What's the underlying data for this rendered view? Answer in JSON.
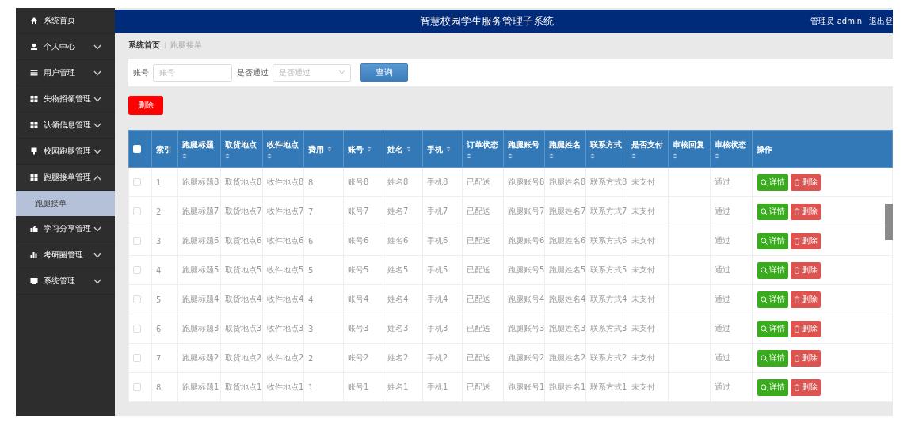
{
  "header": {
    "title": "智慧校园学生服务管理子系统",
    "user": "管理员 admin",
    "logout": "退出登"
  },
  "sidebar": {
    "items": [
      {
        "label": "系统首页",
        "kind": "link"
      },
      {
        "label": "个人中心",
        "kind": "menu",
        "expanded": false
      },
      {
        "label": "用户管理",
        "kind": "menu",
        "expanded": false
      },
      {
        "label": "失物招领管理",
        "kind": "menu",
        "expanded": false
      },
      {
        "label": "认领信息管理",
        "kind": "menu",
        "expanded": false
      },
      {
        "label": "校园跑腿管理",
        "kind": "menu",
        "expanded": false
      },
      {
        "label": "跑腿接单管理",
        "kind": "menu",
        "expanded": true,
        "children": [
          {
            "label": "跑腿接单",
            "selected": true
          }
        ]
      },
      {
        "label": "学习分享管理",
        "kind": "menu",
        "expanded": false
      },
      {
        "label": "考研圈管理",
        "kind": "menu",
        "expanded": false
      },
      {
        "label": "系统管理",
        "kind": "menu",
        "expanded": false
      }
    ]
  },
  "breadcrumb": [
    "系统首页",
    "跑腿接单"
  ],
  "search": {
    "fields": [
      {
        "label": "账号",
        "kind": "input",
        "placeholder": "账号"
      },
      {
        "label": "是否通过",
        "kind": "select",
        "placeholder": "是否通过"
      }
    ],
    "button": "查询"
  },
  "delete_button": "删除",
  "table": {
    "select_all_checked": false,
    "columns": [
      {
        "label": "索引",
        "sortable": false
      },
      {
        "label": "跑腿标题",
        "sortable": true
      },
      {
        "label": "取货地点",
        "sortable": true
      },
      {
        "label": "收件地点",
        "sortable": true
      },
      {
        "label": "费用",
        "sortable": true
      },
      {
        "label": "账号",
        "sortable": true
      },
      {
        "label": "姓名",
        "sortable": true
      },
      {
        "label": "手机",
        "sortable": true
      },
      {
        "label": "订单状态",
        "sortable": true
      },
      {
        "label": "跑腿账号",
        "sortable": true
      },
      {
        "label": "跑腿姓名",
        "sortable": true
      },
      {
        "label": "联系方式",
        "sortable": true
      },
      {
        "label": "是否支付",
        "sortable": true
      },
      {
        "label": "审核回复",
        "sortable": true
      },
      {
        "label": "审核状态",
        "sortable": true
      },
      {
        "label": "操作",
        "sortable": false
      }
    ],
    "rows": [
      {
        "checked": false,
        "cells": [
          "1",
          "跑腿标题8",
          "取货地点8",
          "收件地点8",
          "8",
          "账号8",
          "姓名8",
          "手机8",
          "已配送",
          "跑腿账号8",
          "跑腿姓名8",
          "联系方式8",
          "未支付",
          null,
          "通过"
        ],
        "actions": [
          "详情",
          "删除"
        ]
      },
      {
        "checked": false,
        "cells": [
          "2",
          "跑腿标题7",
          "取货地点7",
          "收件地点7",
          "7",
          "账号7",
          "姓名7",
          "手机7",
          "已配送",
          "跑腿账号7",
          "跑腿姓名7",
          "联系方式7",
          "未支付",
          null,
          "通过"
        ],
        "actions": [
          "详情",
          "删除"
        ]
      },
      {
        "checked": false,
        "cells": [
          "3",
          "跑腿标题6",
          "取货地点6",
          "收件地点6",
          "6",
          "账号6",
          "姓名6",
          "手机6",
          "已配送",
          "跑腿账号6",
          "跑腿姓名6",
          "联系方式6",
          "未支付",
          null,
          "通过"
        ],
        "actions": [
          "详情",
          "删除"
        ]
      },
      {
        "checked": false,
        "cells": [
          "4",
          "跑腿标题5",
          "取货地点5",
          "收件地点5",
          "5",
          "账号5",
          "姓名5",
          "手机5",
          "已配送",
          "跑腿账号5",
          "跑腿姓名5",
          "联系方式5",
          "未支付",
          null,
          "通过"
        ],
        "actions": [
          "详情",
          "删除"
        ]
      },
      {
        "checked": false,
        "cells": [
          "5",
          "跑腿标题4",
          "取货地点4",
          "收件地点4",
          "4",
          "账号4",
          "姓名4",
          "手机4",
          "已配送",
          "跑腿账号4",
          "跑腿姓名4",
          "联系方式4",
          "未支付",
          null,
          "通过"
        ],
        "actions": [
          "详情",
          "删除"
        ]
      },
      {
        "checked": false,
        "cells": [
          "6",
          "跑腿标题3",
          "取货地点3",
          "收件地点3",
          "3",
          "账号3",
          "姓名3",
          "手机3",
          "已配送",
          "跑腿账号3",
          "跑腿姓名3",
          "联系方式3",
          "未支付",
          null,
          "通过"
        ],
        "actions": [
          "详情",
          "删除"
        ]
      },
      {
        "checked": false,
        "cells": [
          "7",
          "跑腿标题2",
          "取货地点2",
          "收件地点2",
          "2",
          "账号2",
          "姓名2",
          "手机2",
          "已配送",
          "跑腿账号2",
          "跑腿姓名2",
          "联系方式2",
          "未支付",
          null,
          "通过"
        ],
        "actions": [
          "详情",
          "删除"
        ]
      },
      {
        "checked": false,
        "cells": [
          "8",
          "跑腿标题1",
          "取货地点1",
          "收件地点1",
          "1",
          "账号1",
          "姓名1",
          "手机1",
          "已配送",
          "跑腿账号1",
          "跑腿姓名1",
          "联系方式1",
          "未支付",
          null,
          "通过"
        ],
        "actions": [
          "详情",
          "删除"
        ]
      }
    ]
  }
}
